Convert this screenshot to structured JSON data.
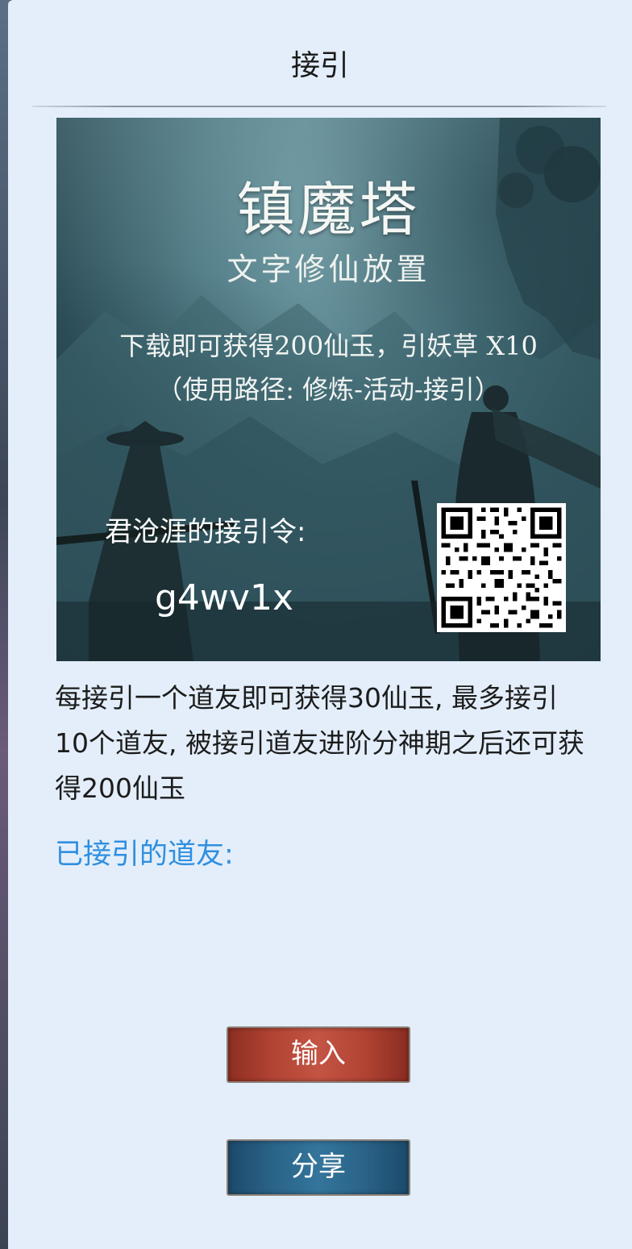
{
  "dialog": {
    "title": "接引"
  },
  "banner": {
    "game_title": "镇魔塔",
    "game_subtitle": "文字修仙放置",
    "reward_text": "下载即可获得200仙玉，引妖草 X10",
    "path_text": "（使用路径: 修炼-活动-接引）",
    "code_label": "君沧涯的接引令:",
    "code_value": "g4wv1x",
    "qr_icon": "qr-code-icon"
  },
  "description": "每接引一个道友即可获得30仙玉, 最多接引10个道友, 被接引道友进阶分神期之后还可获得200仙玉",
  "invited": {
    "label": "已接引的道友:"
  },
  "buttons": {
    "input_label": "输入",
    "share_label": "分享"
  },
  "colors": {
    "background": "#e3eefa",
    "invited_label": "#2f8fe0",
    "input_button": "#b24434",
    "share_button": "#2a6388"
  }
}
